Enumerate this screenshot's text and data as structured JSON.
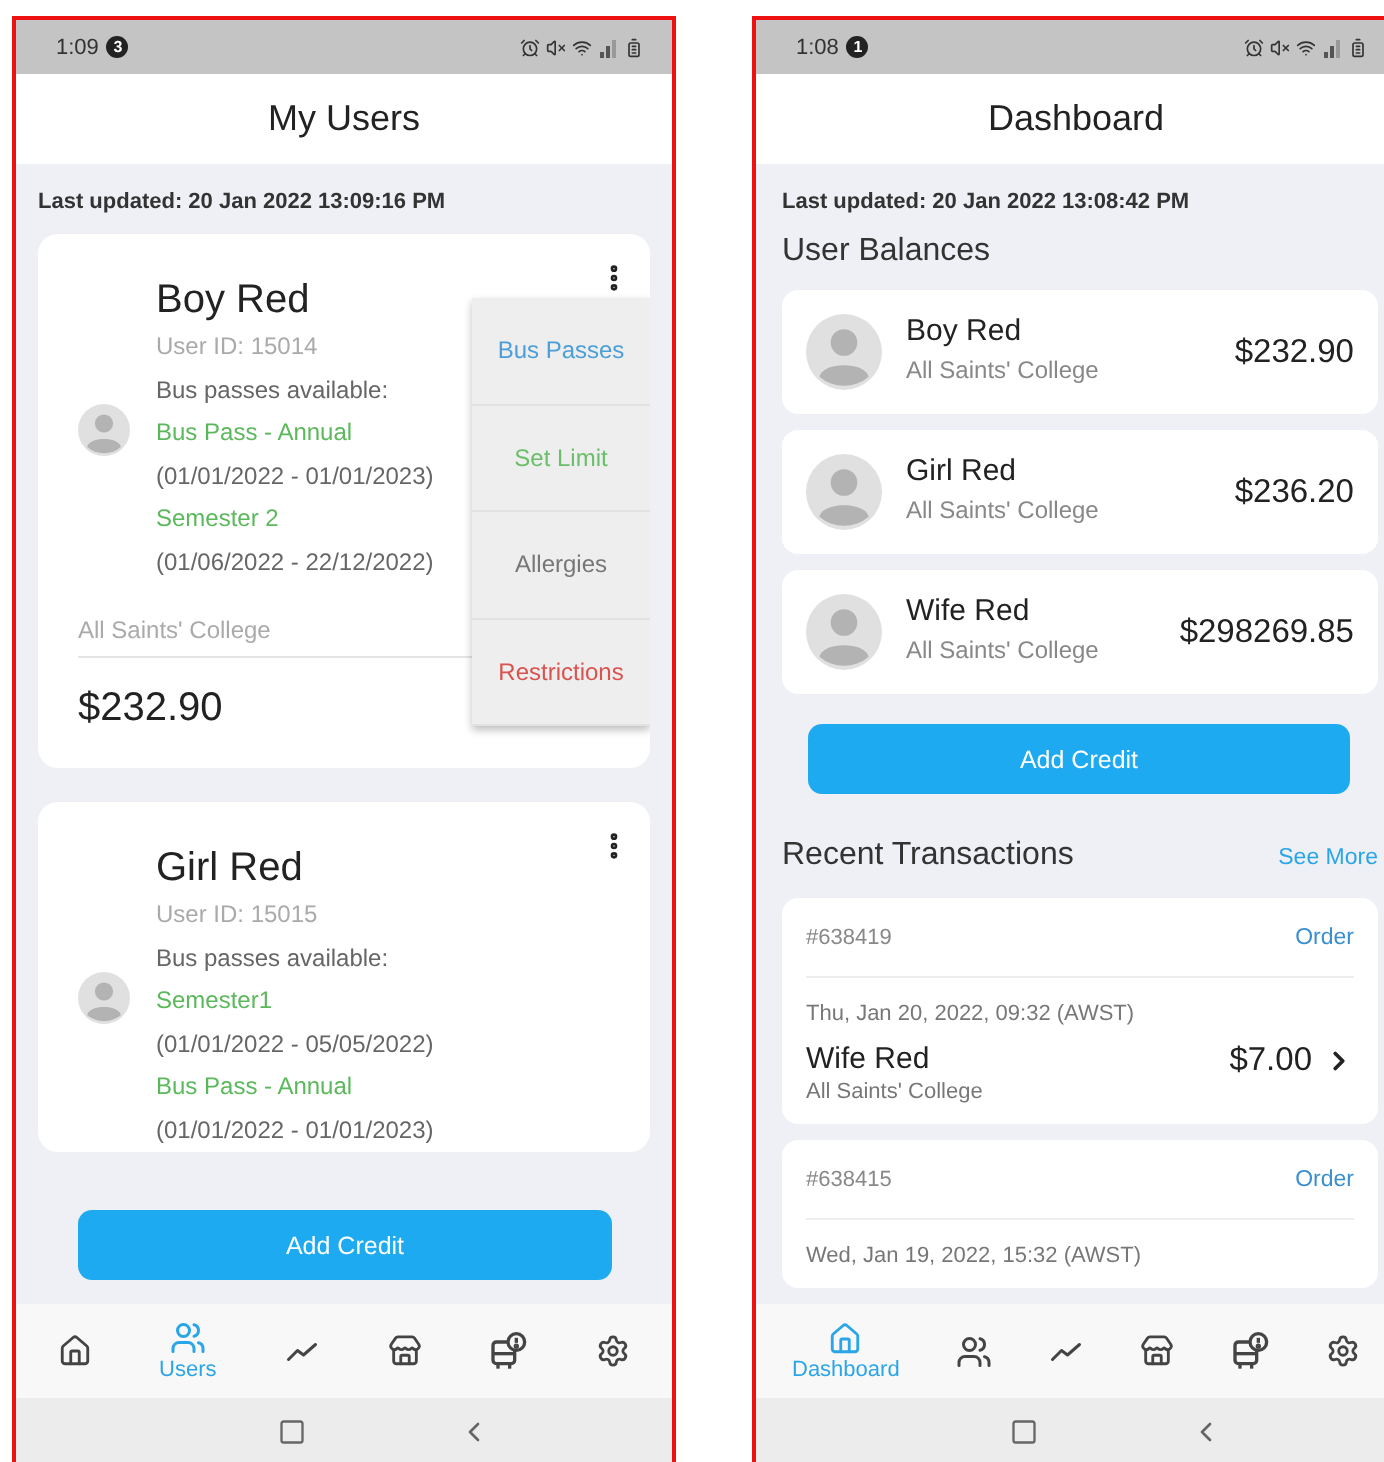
{
  "screens": [
    {
      "kind": "users",
      "status_bar": {
        "time": "1:09",
        "notifications": "3"
      },
      "title": "My Users",
      "last_updated": "Last updated: 20 Jan 2022 13:09:16 PM",
      "users": [
        {
          "name": "Boy Red",
          "user_id": "User ID: 15014",
          "passes_label": "Bus passes available:",
          "passes": [
            {
              "name": "Bus Pass - Annual",
              "dates": "(01/01/2022 - 01/01/2023)"
            },
            {
              "name": "Semester 2",
              "dates": "(01/06/2022 - 22/12/2022)"
            }
          ],
          "school": "All Saints' College",
          "balance": "$232.90",
          "menu_open": true
        },
        {
          "name": "Girl Red",
          "user_id": "User ID: 15015",
          "passes_label": "Bus passes available:",
          "passes": [
            {
              "name": "Semester1",
              "dates": "(01/01/2022 - 05/05/2022)"
            },
            {
              "name": "Bus Pass - Annual",
              "dates": "(01/01/2022 - 01/01/2023)"
            }
          ],
          "menu_open": false
        }
      ],
      "menu": [
        {
          "label": "Bus Passes",
          "color": "#4a9fd8"
        },
        {
          "label": "Set Limit",
          "color": "#6abf69"
        },
        {
          "label": "Allergies",
          "color": "#777777"
        },
        {
          "label": "Restrictions",
          "color": "#d9534f"
        }
      ],
      "add_credit": "Add Credit",
      "nav": [
        {
          "kind": "home",
          "selected": false
        },
        {
          "kind": "users",
          "label": "Users",
          "selected": true
        },
        {
          "kind": "trend",
          "selected": false
        },
        {
          "kind": "store",
          "selected": false
        },
        {
          "kind": "bus",
          "selected": false
        },
        {
          "kind": "settings",
          "selected": false
        }
      ]
    },
    {
      "kind": "dashboard",
      "status_bar": {
        "time": "1:08",
        "notifications": "1"
      },
      "title": "Dashboard",
      "last_updated": "Last updated: 20 Jan 2022 13:08:42 PM",
      "balances_title": "User Balances",
      "balances": [
        {
          "name": "Boy Red",
          "school": "All Saints' College",
          "amount": "$232.90"
        },
        {
          "name": "Girl Red",
          "school": "All Saints' College",
          "amount": "$236.20"
        },
        {
          "name": "Wife Red",
          "school": "All Saints' College",
          "amount": "$298269.85"
        }
      ],
      "add_credit": "Add Credit",
      "transactions_title": "Recent Transactions",
      "see_more": "See More",
      "transactions": [
        {
          "id": "#638419",
          "type": "Order",
          "date": "Thu, Jan 20, 2022, 09:32 (AWST)",
          "name": "Wife Red",
          "school": "All Saints' College",
          "amount": "$7.00"
        },
        {
          "id": "#638415",
          "type": "Order",
          "date": "Wed, Jan 19, 2022, 15:32 (AWST)"
        }
      ],
      "nav": [
        {
          "kind": "home",
          "label": "Dashboard",
          "selected": true
        },
        {
          "kind": "users",
          "selected": false
        },
        {
          "kind": "trend",
          "selected": false
        },
        {
          "kind": "store",
          "selected": false
        },
        {
          "kind": "bus",
          "selected": false
        },
        {
          "kind": "settings",
          "selected": false
        }
      ]
    }
  ]
}
